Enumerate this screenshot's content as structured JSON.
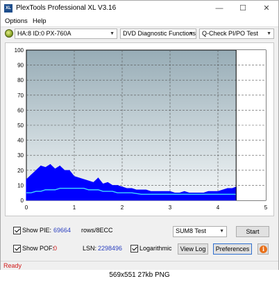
{
  "window": {
    "title": "PlexTools Professional XL V3.16",
    "icon_text": "XL",
    "minimize": "—",
    "maximize": "☐",
    "close": "✕"
  },
  "menu": {
    "options": "Options",
    "help": "Help"
  },
  "toolbar": {
    "drive": "HA:8 ID:0  PX-760A",
    "function": "DVD Diagnostic Functions",
    "test": "Q-Check PI/PO Test"
  },
  "chart_data": {
    "type": "bar",
    "x_ticks": [
      "0",
      "1",
      "2",
      "3",
      "4",
      "5"
    ],
    "y_ticks": [
      "0",
      "10",
      "20",
      "30",
      "40",
      "50",
      "60",
      "70",
      "80",
      "90",
      "100"
    ],
    "xlim": [
      0,
      5
    ],
    "ylim": [
      0,
      100
    ],
    "grid": true,
    "end_marker_x": 4.38,
    "series": [
      {
        "color": "#0000ff",
        "x": [
          0.0,
          0.1,
          0.2,
          0.3,
          0.4,
          0.5,
          0.6,
          0.7,
          0.8,
          0.9,
          1.0,
          1.1,
          1.2,
          1.3,
          1.4,
          1.5,
          1.6,
          1.7,
          1.8,
          1.9,
          2.0,
          2.1,
          2.2,
          2.3,
          2.4,
          2.5,
          2.6,
          2.7,
          2.8,
          2.9,
          3.0,
          3.1,
          3.2,
          3.3,
          3.4,
          3.5,
          3.6,
          3.7,
          3.8,
          3.9,
          4.0,
          4.1,
          4.2,
          4.3,
          4.38
        ],
        "values": [
          14,
          17,
          20,
          23,
          22,
          24,
          21,
          23,
          20,
          20,
          16,
          15,
          14,
          13,
          12,
          15,
          11,
          12,
          10,
          10,
          9,
          8,
          8,
          7,
          7,
          7,
          6,
          6,
          6,
          6,
          6,
          5,
          5,
          6,
          5,
          5,
          5,
          5,
          6,
          6,
          6,
          7,
          8,
          8,
          9
        ]
      },
      {
        "color": "#40d8ff",
        "x": [
          0.0,
          0.1,
          0.2,
          0.3,
          0.4,
          0.5,
          0.6,
          0.7,
          0.8,
          0.9,
          1.0,
          1.1,
          1.2,
          1.3,
          1.4,
          1.5,
          1.6,
          1.7,
          1.8,
          1.9,
          2.0,
          2.2,
          2.4,
          2.6,
          2.8,
          3.0,
          3.2,
          3.4,
          3.6,
          3.8,
          4.0,
          4.2,
          4.38
        ],
        "values": [
          5,
          5,
          6,
          6,
          7,
          7,
          7,
          8,
          8,
          8,
          8,
          8,
          8,
          7,
          7,
          7,
          6,
          6,
          6,
          5,
          5,
          5,
          4,
          4,
          4,
          4,
          4,
          4,
          4,
          4,
          4,
          4,
          4
        ]
      }
    ]
  },
  "controls": {
    "show_pie_label": "Show PIE:",
    "pie_value": "69664",
    "pie_unit": "rows/8ECC",
    "show_pof_label": "Show POF:",
    "pof_value": "0",
    "lsn_label": "LSN:",
    "lsn_value": "2298496",
    "logarithmic_label": "Logarithmic",
    "sum_select": "SUM8 Test",
    "start_button": "Start",
    "view_log_button": "View Log",
    "preferences_button": "Preferences",
    "info_glyph": "i"
  },
  "status": {
    "text": "Ready"
  },
  "caption": {
    "text": "569x551  27kb  PNG"
  }
}
